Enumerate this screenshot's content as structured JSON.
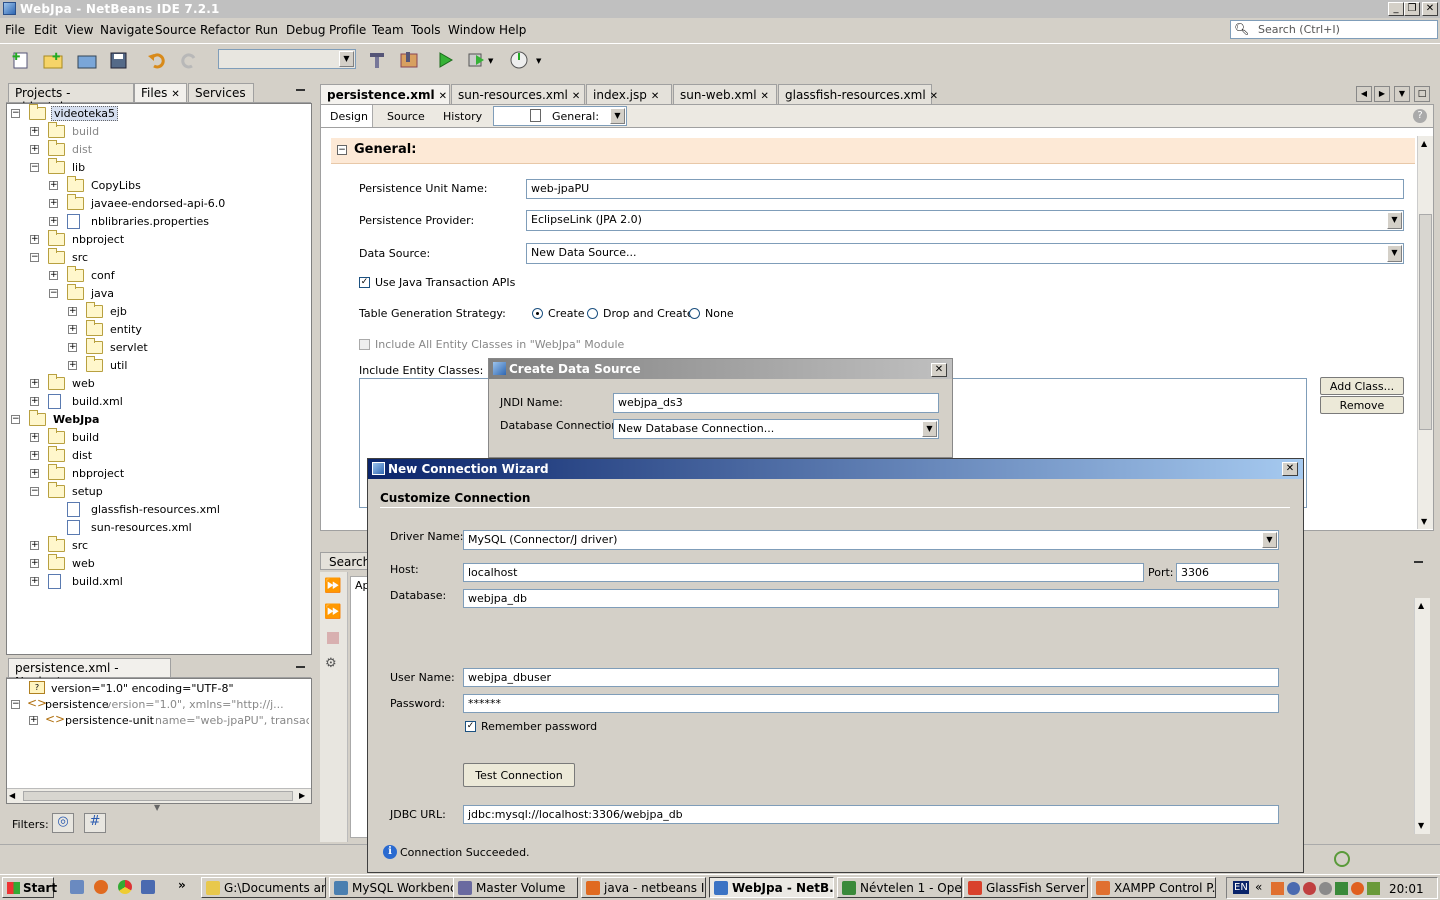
{
  "window": {
    "title": "WebJpa - NetBeans IDE 7.2.1"
  },
  "menu": [
    "File",
    "Edit",
    "View",
    "Navigate",
    "Source",
    "Refactor",
    "Run",
    "Debug",
    "Profile",
    "Team",
    "Tools",
    "Window",
    "Help"
  ],
  "search": {
    "placeholder": "Search (Ctrl+I)"
  },
  "left_tabs": [
    "Projects - videoteka",
    "Files",
    "Services"
  ],
  "tree": [
    {
      "label": "videoteka5",
      "depth": 0,
      "type": "folder",
      "exp": "-",
      "selected": true
    },
    {
      "label": "build",
      "depth": 1,
      "type": "folder",
      "exp": "+",
      "dim": true
    },
    {
      "label": "dist",
      "depth": 1,
      "type": "folder",
      "exp": "+",
      "dim": true
    },
    {
      "label": "lib",
      "depth": 1,
      "type": "folder",
      "exp": "-"
    },
    {
      "label": "CopyLibs",
      "depth": 2,
      "type": "folder",
      "exp": "+"
    },
    {
      "label": "javaee-endorsed-api-6.0",
      "depth": 2,
      "type": "folder",
      "exp": "+"
    },
    {
      "label": "nblibraries.properties",
      "depth": 2,
      "type": "file",
      "exp": "+"
    },
    {
      "label": "nbproject",
      "depth": 1,
      "type": "folder",
      "exp": "+"
    },
    {
      "label": "src",
      "depth": 1,
      "type": "folder",
      "exp": "-"
    },
    {
      "label": "conf",
      "depth": 2,
      "type": "folder",
      "exp": "+"
    },
    {
      "label": "java",
      "depth": 2,
      "type": "folder",
      "exp": "-"
    },
    {
      "label": "ejb",
      "depth": 3,
      "type": "folder",
      "exp": "+"
    },
    {
      "label": "entity",
      "depth": 3,
      "type": "folder",
      "exp": "+"
    },
    {
      "label": "servlet",
      "depth": 3,
      "type": "folder",
      "exp": "+"
    },
    {
      "label": "util",
      "depth": 3,
      "type": "folder",
      "exp": "+"
    },
    {
      "label": "web",
      "depth": 1,
      "type": "folder",
      "exp": "+"
    },
    {
      "label": "build.xml",
      "depth": 1,
      "type": "file",
      "exp": "+"
    },
    {
      "label": "WebJpa",
      "depth": 0,
      "type": "folder",
      "exp": "-",
      "bold": true
    },
    {
      "label": "build",
      "depth": 1,
      "type": "folder",
      "exp": "+"
    },
    {
      "label": "dist",
      "depth": 1,
      "type": "folder",
      "exp": "+"
    },
    {
      "label": "nbproject",
      "depth": 1,
      "type": "folder",
      "exp": "+"
    },
    {
      "label": "setup",
      "depth": 1,
      "type": "folder",
      "exp": "-"
    },
    {
      "label": "glassfish-resources.xml",
      "depth": 2,
      "type": "file",
      "exp": ""
    },
    {
      "label": "sun-resources.xml",
      "depth": 2,
      "type": "file",
      "exp": ""
    },
    {
      "label": "src",
      "depth": 1,
      "type": "folder",
      "exp": "+"
    },
    {
      "label": "web",
      "depth": 1,
      "type": "folder",
      "exp": "+"
    },
    {
      "label": "build.xml",
      "depth": 1,
      "type": "file",
      "exp": "+"
    }
  ],
  "navigator": {
    "title": "persistence.xml - Navigator",
    "rows": [
      {
        "name": "version=\"1.0\" encoding=\"UTF-8\"",
        "attrs": ""
      },
      {
        "name": "persistence",
        "attrs": "version=\"1.0\", xmlns=\"http://j..."
      },
      {
        "name": "persistence-unit",
        "attrs": "name=\"web-jpaPU\", transaction-..."
      }
    ],
    "filters_label": "Filters:"
  },
  "editor_tabs": [
    "persistence.xml",
    "sun-resources.xml",
    "index.jsp",
    "sun-web.xml",
    "glassfish-resources.xml"
  ],
  "view_tabs": [
    "Design",
    "Source",
    "History"
  ],
  "section_combo": "General:",
  "general": {
    "header": "General:",
    "pu_name_label": "Persistence Unit Name:",
    "pu_name": "web-jpaPU",
    "provider_label": "Persistence Provider:",
    "provider": "EclipseLink (JPA 2.0)",
    "datasource_label": "Data Source:",
    "datasource": "New Data Source...",
    "jta_label": "Use Java Transaction APIs",
    "strategy_label": "Table Generation Strategy:",
    "strategy_options": [
      "Create",
      "Drop and Create",
      "None"
    ],
    "include_all_label": "Include All Entity Classes in \"WebJpa\" Module",
    "include_classes_label": "Include Entity Classes:",
    "add_class": "Add Class...",
    "remove": "Remove"
  },
  "output": {
    "search_tab": "Search",
    "ap_tab": "Ap"
  },
  "create_ds": {
    "title": "Create Data Source",
    "jndi_label": "JNDI Name:",
    "jndi": "webjpa_ds3",
    "dbconn_label": "Database Connection:",
    "dbconn": "New Database Connection..."
  },
  "wizard": {
    "title": "New Connection Wizard",
    "subtitle": "Customize Connection",
    "driver_label": "Driver Name:",
    "driver": "MySQL (Connector/J driver)",
    "host_label": "Host:",
    "host": "localhost",
    "port_label": "Port:",
    "port": "3306",
    "db_label": "Database:",
    "db": "webjpa_db",
    "user_label": "User Name:",
    "user": "webjpa_dbuser",
    "pass_label": "Password:",
    "pass": "******",
    "remember": "Remember password",
    "test_btn": "Test Connection",
    "jdbc_label": "JDBC URL:",
    "jdbc": "jdbc:mysql://localhost:3306/webjpa_db",
    "status": "Connection Succeeded."
  },
  "taskbar": {
    "start": "Start",
    "tasks": [
      {
        "label": "G:\\Documents an...",
        "color": "#e8c84c"
      },
      {
        "label": "MySQL Workbench",
        "color": "#4a7fb0"
      },
      {
        "label": "Master Volume",
        "color": "#6a6aa0"
      },
      {
        "label": "java - netbeans I...",
        "color": "#e06a20"
      },
      {
        "label": "WebJpa - NetB...",
        "color": "#3b73c4",
        "active": true
      },
      {
        "label": "Névtelen 1 - Ope...",
        "color": "#3a8a3a"
      },
      {
        "label": "GlassFish Server ...",
        "color": "#d9412c"
      },
      {
        "label": "XAMPP Control P...",
        "color": "#e07030"
      }
    ],
    "lang": "EN",
    "time": "20:01"
  },
  "colors": {
    "accent_title": "#0a246a",
    "section_bg": "#fde9d6"
  }
}
